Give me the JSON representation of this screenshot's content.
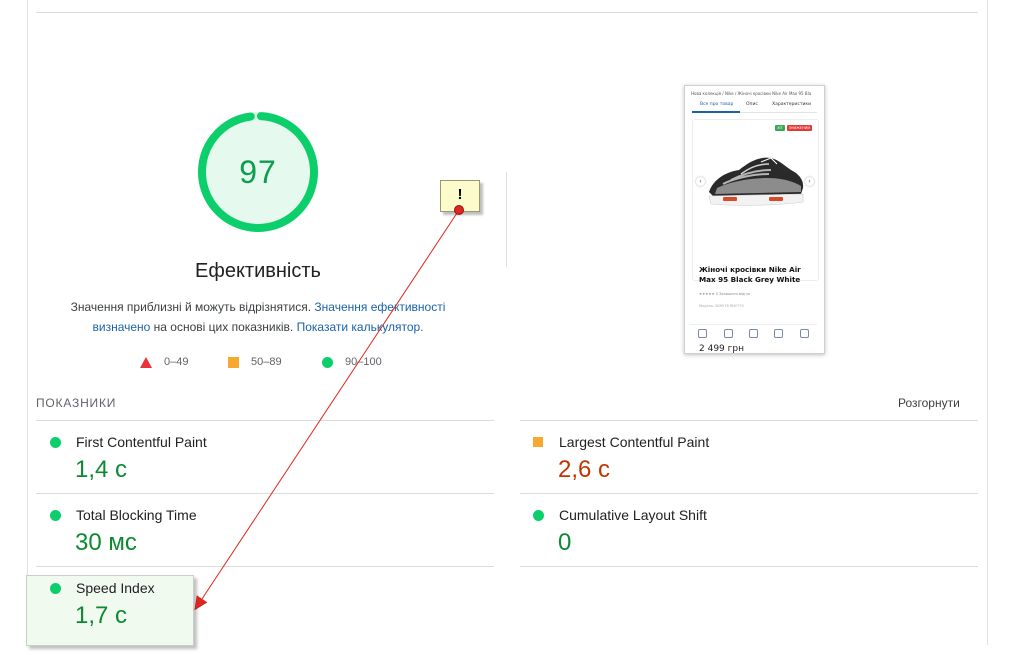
{
  "performance": {
    "score": "97",
    "score_fraction": 0.97,
    "title": "Ефективність",
    "disclaimer_text": "Значення приблизні й можуть відрізнятися.",
    "disclaimer_link": "Значення ефективності визначено",
    "disclaimer_middle": "на основі цих показників.",
    "calculator_link": "Показати калькулятор.",
    "legend": [
      {
        "shape": "triangle",
        "range": "0–49",
        "color": "#e8333a"
      },
      {
        "shape": "square",
        "range": "50–89",
        "color": "#f6a82f"
      },
      {
        "shape": "circle",
        "range": "90–100",
        "color": "#0cce6b"
      }
    ]
  },
  "screenshot": {
    "breadcrumb": "Нова колекція / Nike / Жіночі кросівки Nike Air Max 95 Bla",
    "tabs": [
      "Все про товар",
      "Опис",
      "Характеристики"
    ],
    "badges": [
      "ХІТ",
      "ЗНИЖЕНИЙ"
    ],
    "product_title": "Жіночі кросівки Nike Air Max 95 Black Grey White",
    "rating_text": "★★★★★ 0 Залишити відгук",
    "meta_text": "Модель: 809578 RNY770",
    "price": "2 499 грн"
  },
  "metrics": {
    "section_label": "ПОКАЗНИКИ",
    "expand_label": "Розгорнути",
    "items": [
      {
        "name": "First Contentful Paint",
        "value": "1,4 с",
        "status": "pass"
      },
      {
        "name": "Largest Contentful Paint",
        "value": "2,6 с",
        "status": "average"
      },
      {
        "name": "Total Blocking Time",
        "value": "30 мс",
        "status": "pass"
      },
      {
        "name": "Cumulative Layout Shift",
        "value": "0",
        "status": "pass"
      },
      {
        "name": "Speed Index",
        "value": "1,7 с",
        "status": "pass"
      }
    ]
  },
  "annotation": {
    "note": "!",
    "arrow_color": "#e0261e"
  },
  "colors": {
    "pass": "#0cce6b",
    "pass_text": "#0c8a32",
    "average": "#f6a82f",
    "average_text": "#c33300",
    "link": "#1a62a8"
  }
}
